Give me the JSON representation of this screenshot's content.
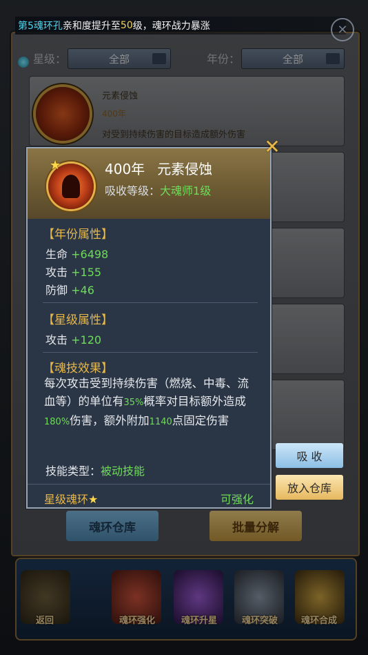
{
  "banner": {
    "prefix": "第5",
    "part1": "魂环孔",
    "part2": "亲和度提升至",
    "number": "50",
    "part3": "级，魂环战力暴涨"
  },
  "filters": {
    "star_label": "星级：",
    "star_value": "全部",
    "year_label": "年份：",
    "year_value": "全部"
  },
  "background_item": {
    "title": "元素侵蚀",
    "year": "400年",
    "desc": "对受到持续伤害的目标造成额外伤害"
  },
  "bottom_buttons": {
    "warehouse": "魂环仓库",
    "batch": "批量分解"
  },
  "bottom_nav": [
    {
      "label": "返回"
    },
    {
      "label": "魂环强化"
    },
    {
      "label": "魂环升星"
    },
    {
      "label": "魂环突破"
    },
    {
      "label": "魂环合成"
    }
  ],
  "tooltip": {
    "year": "400年",
    "name": "元素侵蚀",
    "absorb_label": "吸收等级：",
    "absorb_value": "大魂师1级",
    "year_attr_title": "【年份属性】",
    "year_attrs": [
      {
        "name": "生命",
        "value": "+6498"
      },
      {
        "name": "攻击",
        "value": "+155"
      },
      {
        "name": "防御",
        "value": "+46"
      }
    ],
    "star_attr_title": "【星级属性】",
    "star_attrs": [
      {
        "name": "攻击",
        "value": "+120"
      }
    ],
    "skill_title": "【魂技效果】",
    "skill_desc": {
      "a": "每次攻击受到持续伤害（燃烧、中毒、流血等）的单位有",
      "p1": "35%",
      "b": "概率对目标额外造成",
      "p2": "180%",
      "c": "伤害，额外附加",
      "p3": "1140",
      "d": "点固定伤害"
    },
    "skill_type_label": "技能类型：",
    "skill_type_value": "被动技能",
    "footer_left": "星级魂环",
    "footer_right": "可强化"
  },
  "side_buttons": {
    "absorb": "吸 收",
    "store": "放入仓库"
  },
  "colors": {
    "gold": "#e8b84a",
    "green": "#6fdc5a",
    "panel": "#2a3545"
  }
}
